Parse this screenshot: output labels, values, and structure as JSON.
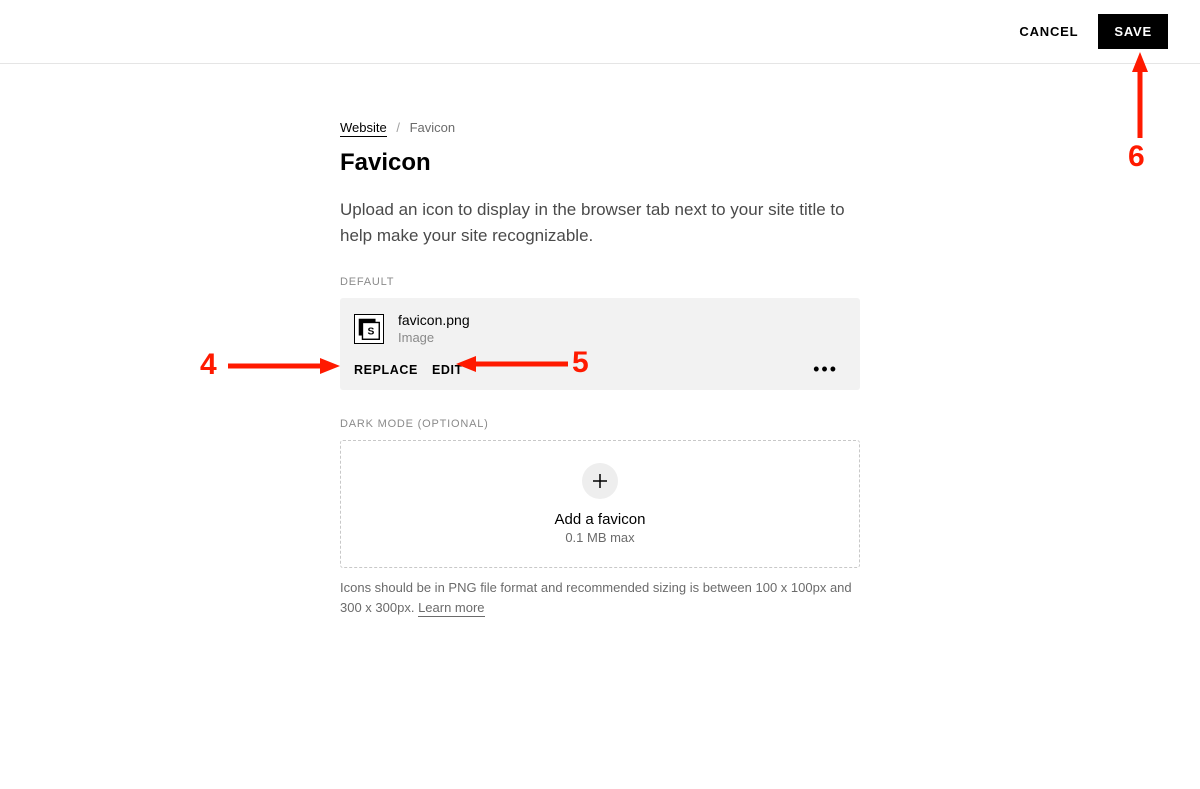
{
  "topbar": {
    "cancel_label": "CANCEL",
    "save_label": "SAVE"
  },
  "breadcrumb": {
    "root": "Website",
    "separator": "/",
    "current": "Favicon"
  },
  "page": {
    "title": "Favicon",
    "description": "Upload an icon to display in the browser tab next to your site title to help make your site recognizable."
  },
  "default_section": {
    "label": "DEFAULT",
    "file_name": "favicon.png",
    "file_type": "Image",
    "replace_label": "REPLACE",
    "edit_label": "EDIT",
    "more_label": "•••"
  },
  "dark_section": {
    "label": "DARK MODE (OPTIONAL)",
    "upload_title": "Add a favicon",
    "upload_sub": "0.1 MB max"
  },
  "help": {
    "text": "Icons should be in PNG file format and recommended sizing is between 100 x 100px and 300 x 300px. ",
    "learn_more": "Learn more"
  },
  "annotations": {
    "label_4": "4",
    "label_5": "5",
    "label_6": "6"
  }
}
